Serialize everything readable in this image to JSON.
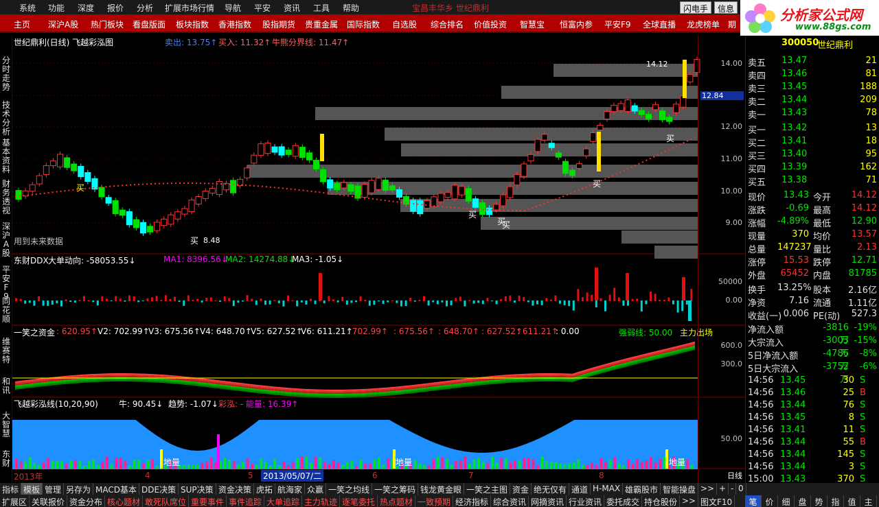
{
  "menu": {
    "items": [
      "系统",
      "功能",
      "深度",
      "报价",
      "分析",
      "扩展市场行情",
      "导航",
      "平安",
      "资讯",
      "工具",
      "帮助"
    ],
    "center": "宝昌丰华乡    世纪鼎利",
    "right_buttons": [
      "闪电手",
      "信息"
    ]
  },
  "logo": {
    "name": "分析家公式网",
    "url": "www.88gs.com"
  },
  "nav": [
    "主页",
    "深沪A股",
    "热门板块",
    "看盘版面",
    "板块指数",
    "香港指数",
    "股指期货",
    "贵重金属",
    "国际指数",
    "自选股",
    "综合排名",
    "价值投资",
    "智慧宝",
    "恒富内参",
    "平安F9",
    "全球直播",
    "龙虎榜单",
    "期"
  ],
  "leftstrip": [
    "分时走势",
    "技术分析",
    "基本资料",
    "财务透视",
    "深沪A股",
    "平安F9",
    "同花顺",
    "维赛特",
    "和讯",
    "大智慧",
    "东财"
  ],
  "price_panel": {
    "title": "世纪鼎利(日线) 飞越彩泓图",
    "sell": "卖出: 13.75↑",
    "buy": "买入: 11.32↑",
    "bull_bear": "牛熊分界线: 11.47↑",
    "future_note": "用到未来数据",
    "high_label": "14.12",
    "low_label": "8.48",
    "buy_marker": "买",
    "current_price_tag": "12.84",
    "y_ticks": [
      "14.00",
      "13.00",
      "12.00",
      "11.00",
      "10.00",
      "9.00"
    ]
  },
  "ddx_panel": {
    "title": "东财DDX",
    "dir": "大单动向: -58053.55↓",
    "ma1": "MA1: 8396.56↓",
    "ma2": "MA2: 14274.88↓",
    "ma3": "MA3: -1.05↓",
    "y_ticks": [
      "50000",
      "0.00"
    ]
  },
  "fund_panel": {
    "title": "一笑之资金",
    "v1": ": 620.95↑",
    "v2": "V2: 702.99↑",
    "v3": "V3: 675.56↑",
    "v4": "V4: 648.70↑",
    "v5": "V5: 627.52↑",
    "v6": "V6: 611.21↑",
    "r1": ": 702.99↑",
    "r2": ": 675.56↑",
    "r3": ": 648.70↑",
    "r4": ": 627.52↑",
    "r5": ": 611.21↑",
    "r6": ": 0.00",
    "strength": "强弱线: 50.00",
    "main_out": "主力出场",
    "y_ticks": [
      "600.0",
      "300.0"
    ]
  },
  "rainbow_panel": {
    "title": "飞越彩泓线(10,20,90)",
    "bull": "牛: 90.45↓",
    "trend": "趋势: -1.07↓",
    "rainbow": "彩泓: -",
    "energy": "能量: 16.39↑",
    "marker1": "地量",
    "marker2": "地量",
    "marker3": "地量",
    "y_ticks": [
      "50.00"
    ]
  },
  "timeline": {
    "year": "2013年",
    "months": [
      "4",
      "5",
      "6",
      "7",
      "8"
    ],
    "date": "2013/05/07/二",
    "period": "日线"
  },
  "quote": {
    "code": "300050",
    "name": "世纪鼎利",
    "asks": [
      {
        "label": "卖五",
        "price": "13.47",
        "vol": "21"
      },
      {
        "label": "卖四",
        "price": "13.46",
        "vol": "81"
      },
      {
        "label": "卖三",
        "price": "13.45",
        "vol": "188"
      },
      {
        "label": "卖二",
        "price": "13.44",
        "vol": "209"
      },
      {
        "label": "卖一",
        "price": "13.43",
        "vol": "78"
      }
    ],
    "bids": [
      {
        "label": "买一",
        "price": "13.42",
        "vol": "13"
      },
      {
        "label": "买二",
        "price": "13.41",
        "vol": "18"
      },
      {
        "label": "买三",
        "price": "13.40",
        "vol": "95"
      },
      {
        "label": "买四",
        "price": "13.39",
        "vol": "162"
      },
      {
        "label": "买五",
        "price": "13.38",
        "vol": "71"
      }
    ],
    "stats": [
      {
        "l1": "现价",
        "v1": "13.43",
        "l2": "今开",
        "v2": "14.12"
      },
      {
        "l1": "涨跌",
        "v1": "-0.69",
        "l2": "最高",
        "v2": "14.12"
      },
      {
        "l1": "涨幅",
        "v1": "-4.89%",
        "l2": "最低",
        "v2": "12.90"
      },
      {
        "l1": "现量",
        "v1": "370",
        "l2": "均价",
        "v2": "13.57"
      },
      {
        "l1": "总量",
        "v1": "147237",
        "l2": "量比",
        "v2": "2.13"
      },
      {
        "l1": "涨停",
        "v1": "15.53",
        "l2": "跌停",
        "v2": "12.71"
      },
      {
        "l1": "外盘",
        "v1": "65452",
        "l2": "内盘",
        "v2": "81785"
      }
    ],
    "stats2": [
      {
        "l1": "换手",
        "v1": "13.25%",
        "l2": "股本",
        "v2": "2.16亿"
      },
      {
        "l1": "净资",
        "v1": "7.16",
        "l2": "流通",
        "v2": "1.11亿"
      },
      {
        "l1": "收益(一)",
        "v1": "0.006",
        "l2": "PE(动)",
        "v2": "527.3"
      }
    ],
    "flows": [
      {
        "label": "净流入额",
        "value": "-3816万",
        "pct": "-19%"
      },
      {
        "label": "大宗流入",
        "value": "-3003万",
        "pct": "-15%"
      },
      {
        "label": "5日净流入额",
        "value": "-4786万",
        "pct": "-8%"
      },
      {
        "label": "5日大宗流入",
        "value": "-3752万",
        "pct": "-6%"
      }
    ],
    "ticks": [
      {
        "time": "14:56",
        "price": "13.45",
        "vol": "30",
        "dir": "S"
      },
      {
        "time": "14:56",
        "price": "13.46",
        "vol": "25",
        "dir": "B"
      },
      {
        "time": "14:56",
        "price": "13.44",
        "vol": "76",
        "dir": "S"
      },
      {
        "time": "14:56",
        "price": "13.45",
        "vol": "8",
        "dir": "S"
      },
      {
        "time": "14:56",
        "price": "13.41",
        "vol": "11",
        "dir": "S"
      },
      {
        "time": "14:56",
        "price": "13.44",
        "vol": "55",
        "dir": "B"
      },
      {
        "time": "14:56",
        "price": "13.44",
        "vol": "145",
        "dir": "S"
      },
      {
        "time": "14:56",
        "price": "13.44",
        "vol": "3",
        "dir": "S"
      },
      {
        "time": "15:00",
        "price": "13.43",
        "vol": "370",
        "dir": "S"
      }
    ]
  },
  "footer": {
    "row1": [
      "指标",
      "模板",
      "管理",
      "另存为",
      "MACD基本",
      "DDE决策",
      "SUP决策",
      "资金决策",
      "虎拓",
      "航海家",
      "众赢",
      "一笑之均线",
      "一笑之筹码",
      "钱龙黄金眼",
      "一笑之主图",
      "资金",
      "绝无仅有",
      "通道",
      "H-MAX",
      "雄霸股市",
      "智能操盘",
      ">>",
      "+",
      "-",
      "0"
    ],
    "row2": [
      "扩展区",
      "关联报价",
      "资金分布",
      "核心题材",
      "敢死队席位",
      "重要事件",
      "事件追踪",
      "大单追踪",
      "主力轨迹",
      "逐笔委托",
      "热点题材",
      "一致预期",
      "经济指标",
      "综合资讯",
      "网摘资讯",
      "行业资讯",
      "委托成交",
      "持仓股份",
      ">>",
      "图文F10"
    ],
    "right_tabs": [
      "笔",
      "价",
      "细",
      "盘",
      "势",
      "指",
      "值",
      "主"
    ]
  },
  "colors": {
    "up": "#ff3232",
    "down": "#00e0e0",
    "bull": "#ff0000",
    "bear": "#00c000",
    "accent": "#b00000"
  }
}
